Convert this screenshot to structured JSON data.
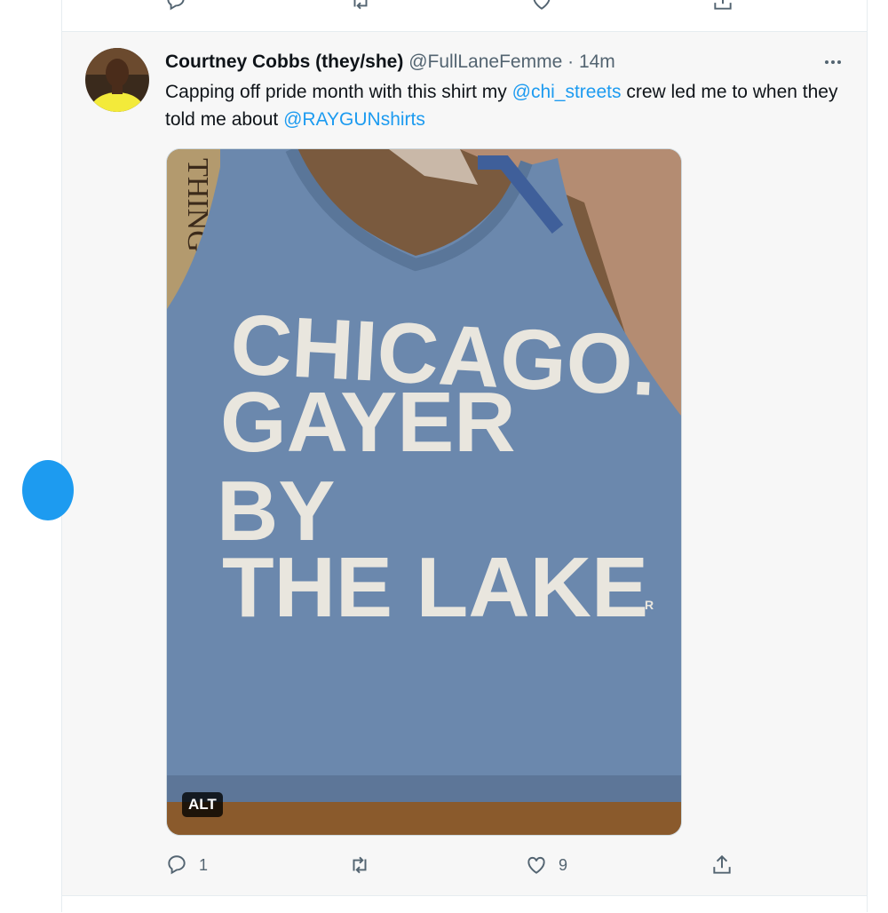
{
  "tweet": {
    "author_name": "Courtney Cobbs (they/she)",
    "handle": "@FullLaneFemme",
    "separator": "·",
    "time": "14m",
    "text_part1": "Capping off pride month with this shirt my ",
    "mention1": "@chi_streets",
    "text_part2": " crew led me to when they told me about ",
    "mention2": "@RAYGUNshirts",
    "media": {
      "shirt_line1": "CHICAGO.",
      "shirt_line2": "GAYER",
      "shirt_line3": "BY",
      "shirt_line4": "THE LAKE",
      "registered_mark": "R",
      "background_text": "THING",
      "alt_label": "ALT"
    },
    "actions": {
      "reply_count": "1",
      "retweet_count": "",
      "like_count": "9"
    }
  },
  "colors": {
    "accent": "#1d9bf0",
    "secondary_text": "#536471",
    "shirt": "#6b88ad"
  },
  "icons": [
    "reply-icon",
    "retweet-icon",
    "like-icon",
    "share-icon",
    "more-icon"
  ]
}
